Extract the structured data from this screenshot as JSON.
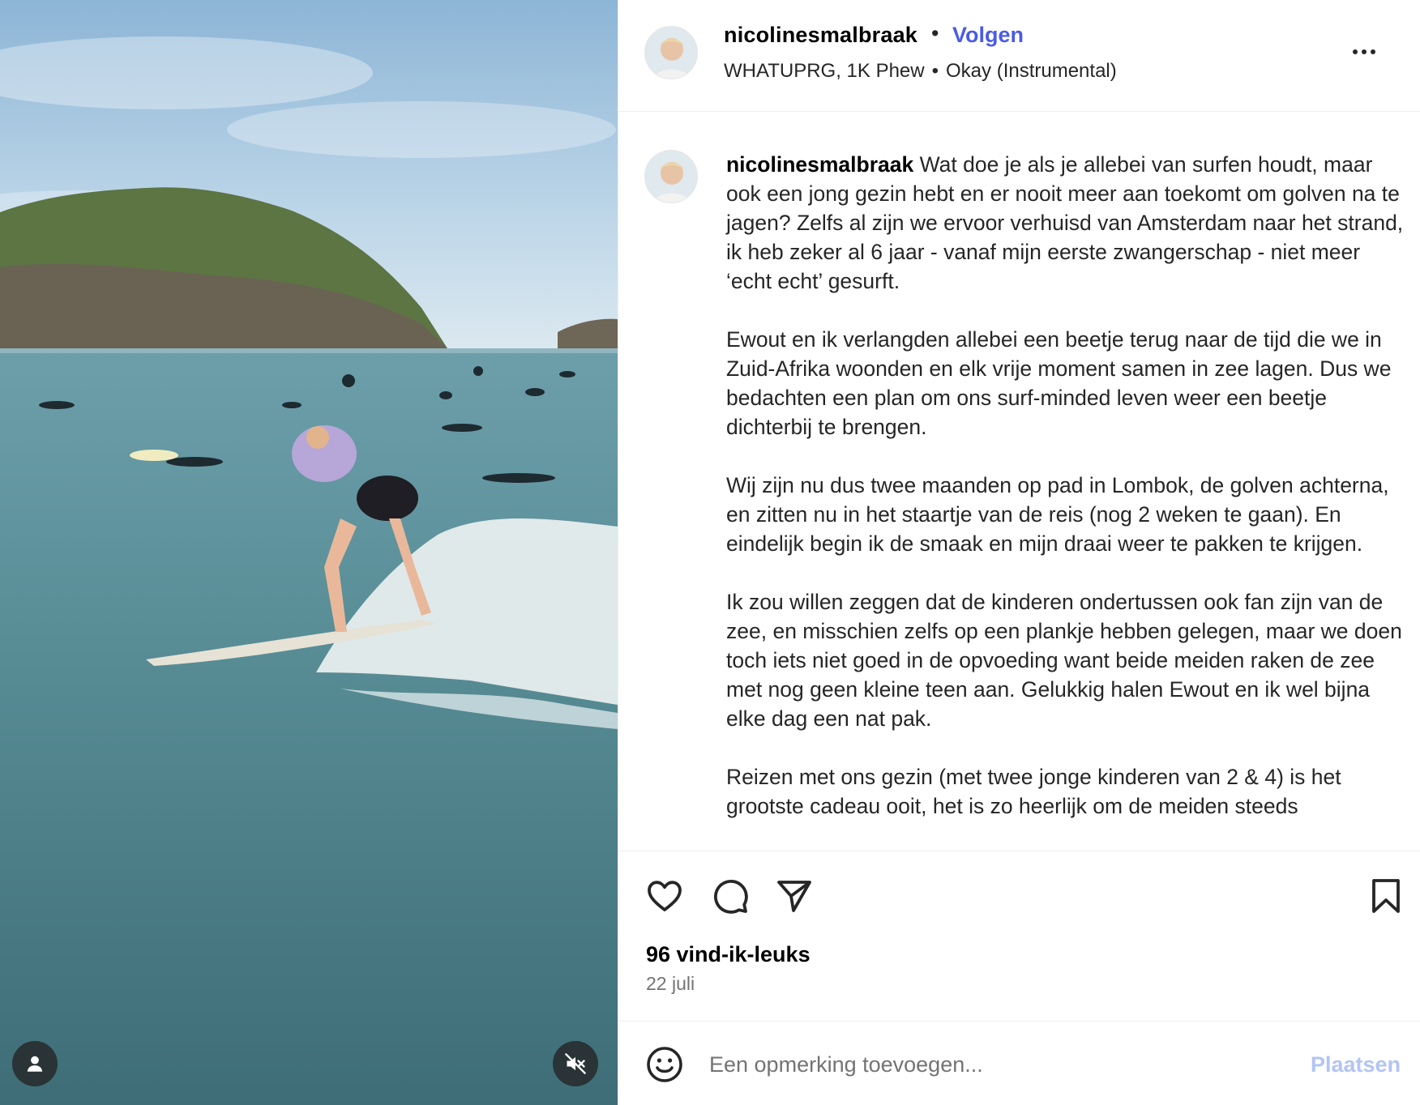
{
  "post": {
    "username": "nicolinesmalbraak",
    "follow_label": "Volgen",
    "audio_artist": "WHATUPRG, 1K Phew",
    "audio_track": "Okay (Instrumental)",
    "separator": "•"
  },
  "caption": {
    "username": "nicolinesmalbraak",
    "paragraphs": [
      "Wat doe je als je allebei van surfen houdt, maar ook een jong gezin hebt en er nooit meer aan toekomt om golven na te jagen? Zelfs al zijn we ervoor verhuisd van Amsterdam naar het strand, ik heb zeker al 6 jaar - vanaf mijn eerste zwangerschap - niet meer ‘echt echt’ gesurft.",
      "Ewout en ik verlangden allebei een beetje terug naar de tijd die we in Zuid-Afrika woonden en elk vrije moment samen in zee lagen. Dus we bedachten een plan om ons surf-minded leven weer een beetje dichterbij te brengen.",
      "Wij zijn nu dus twee maanden op pad in Lombok, de golven achterna, en zitten nu in het staartje van de reis (nog 2 weken te gaan). En eindelijk begin ik de smaak en mijn draai weer te pakken te krijgen.",
      "Ik zou willen zeggen dat de kinderen ondertussen ook fan zijn van de zee, en misschien zelfs op een plankje hebben gelegen, maar we doen toch iets niet goed in de opvoeding want beide meiden raken de zee met nog geen kleine teen aan. Gelukkig halen Ewout en ik wel bijna elke dag een nat pak.",
      "Reizen met ons gezin (met twee jonge kinderen van 2 & 4) is het grootste cadeau ooit, het is zo heerlijk om de meiden steeds"
    ]
  },
  "stats": {
    "likes": "96 vind-ik-leuks",
    "date": "22 juli"
  },
  "comment": {
    "placeholder": "Een opmerking toevoegen...",
    "post_label": "Plaatsen"
  },
  "icons": {
    "like": "heart-icon",
    "comment": "comment-bubble-icon",
    "share": "paper-plane-icon",
    "save": "bookmark-icon",
    "more": "more-horizontal-icon",
    "emoji": "emoji-icon",
    "tagged_users": "user-tag-icon",
    "audio": "muted-speaker-icon"
  },
  "colors": {
    "follow": "#4a5be6",
    "post_disabled": "#b3c4f5",
    "secondary_text": "#737373"
  }
}
